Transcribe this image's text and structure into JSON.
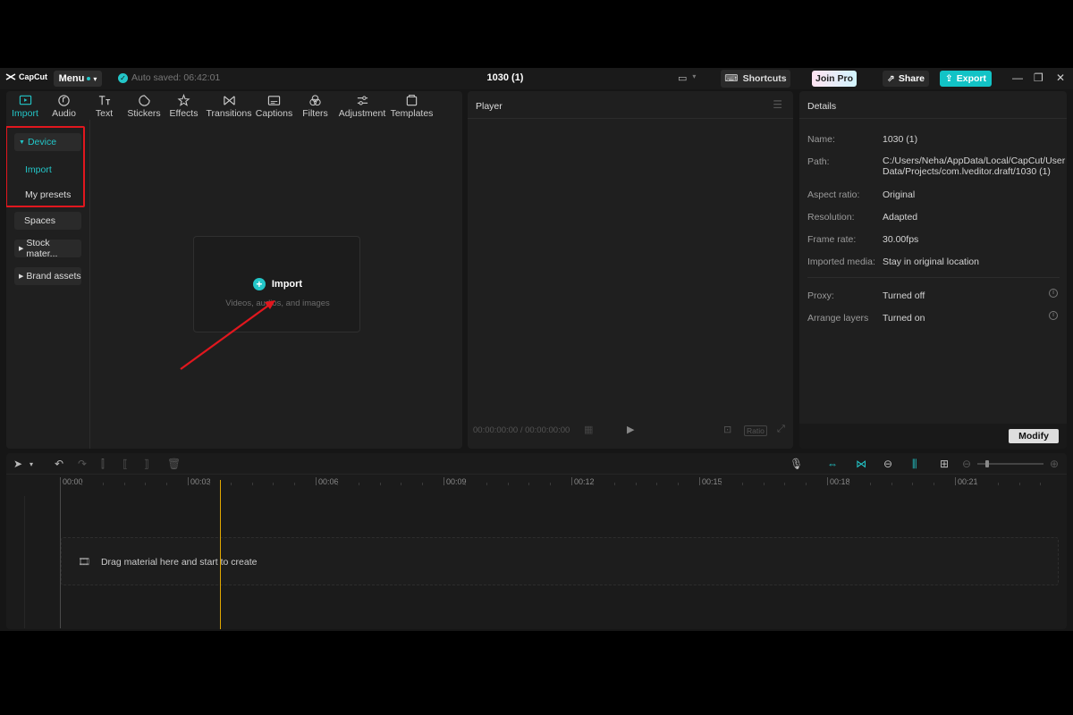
{
  "app": {
    "logo_text": "CapCut",
    "menu_label": "Menu",
    "autosave": "Auto saved: 06:42:01",
    "project_title": "1030 (1)",
    "shortcuts_label": "Shortcuts",
    "joinpro_label": "Join Pro",
    "share_label": "Share",
    "export_label": "Export",
    "accent": "#23c6c8"
  },
  "media": {
    "tabs": [
      {
        "label": "Import",
        "icon": "import-icon"
      },
      {
        "label": "Audio",
        "icon": "audio-icon"
      },
      {
        "label": "Text",
        "icon": "text-icon"
      },
      {
        "label": "Stickers",
        "icon": "stickers-icon"
      },
      {
        "label": "Effects",
        "icon": "effects-icon"
      },
      {
        "label": "Transitions",
        "icon": "transitions-icon"
      },
      {
        "label": "Captions",
        "icon": "captions-icon"
      },
      {
        "label": "Filters",
        "icon": "filters-icon"
      },
      {
        "label": "Adjustment",
        "icon": "adjustment-icon"
      },
      {
        "label": "Templates",
        "icon": "templates-icon"
      }
    ],
    "sidebar": {
      "device": "Device",
      "import": "Import",
      "my_presets": "My presets",
      "spaces": "Spaces",
      "stock": "Stock mater...",
      "brand": "Brand assets"
    },
    "import_box": {
      "label": "Import",
      "hint": "Videos, audios, and images"
    }
  },
  "player": {
    "title": "Player",
    "timecode": "00:00:00:00 / 00:00:00:00",
    "ratio_label": "Ratio"
  },
  "details": {
    "title": "Details",
    "rows": [
      {
        "label": "Name:",
        "value": "1030 (1)"
      },
      {
        "label": "Path:",
        "value": "C:/Users/Neha/AppData/Local/CapCut/User Data/Projects/com.lveditor.draft/1030 (1)"
      },
      {
        "label": "Aspect ratio:",
        "value": "Original"
      },
      {
        "label": "Resolution:",
        "value": "Adapted"
      },
      {
        "label": "Frame rate:",
        "value": "30.00fps"
      },
      {
        "label": "Imported media:",
        "value": "Stay in original location"
      },
      {
        "label": "Proxy:",
        "value": "Turned off"
      },
      {
        "label": "Arrange layers",
        "value": "Turned on"
      }
    ],
    "modify_label": "Modify"
  },
  "timeline": {
    "ticks": [
      "00:00",
      "00:03",
      "00:06",
      "00:09",
      "00:12",
      "00:15",
      "00:18",
      "00:21"
    ],
    "drop_hint": "Drag material here and start to create"
  }
}
